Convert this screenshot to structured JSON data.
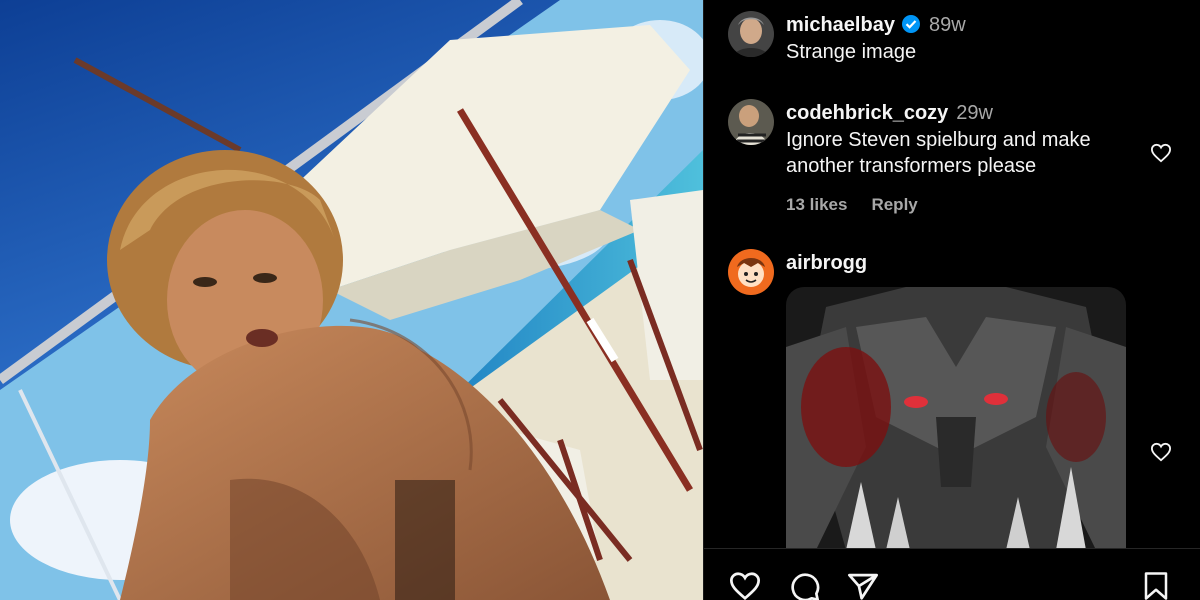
{
  "post": {
    "comments": [
      {
        "username": "michaelbay",
        "verified": true,
        "time": "89w",
        "text_lines": [
          "Strange image"
        ]
      },
      {
        "username": "codehbrick_cozy",
        "time": "29w",
        "text_lines": [
          "Ignore Steven spielburg and make",
          "another transformers please"
        ],
        "likes": "13 likes",
        "reply": "Reply"
      },
      {
        "username": "airbrogg",
        "text_lines": []
      }
    ]
  },
  "icons": [
    "verified-badge-icon",
    "heart-icon",
    "comment-icon",
    "share-icon",
    "bookmark-icon"
  ],
  "colors": {
    "background": "#000000",
    "text": "#f5f5f5",
    "secondary": "#a8a8a8",
    "verified": "#0095f6"
  }
}
